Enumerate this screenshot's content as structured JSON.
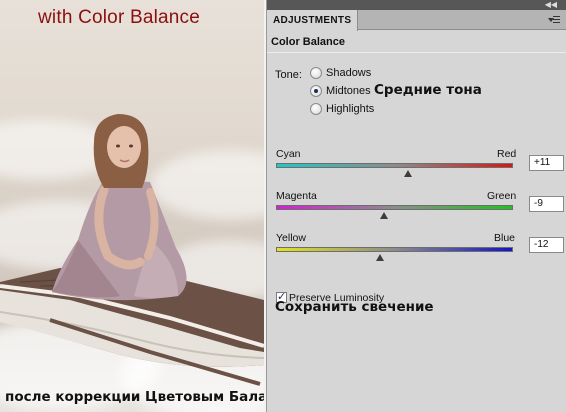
{
  "photo": {
    "title": "with Color Balance",
    "caption": "после коррекции Цветовым Балансом"
  },
  "panel": {
    "tab_label": "ADJUSTMENTS",
    "title": "Color Balance",
    "tone_label": "Tone:",
    "tones": [
      {
        "label": "Shadows",
        "selected": false
      },
      {
        "label": "Midtones",
        "selected": true
      },
      {
        "label": "Highlights",
        "selected": false
      }
    ],
    "tone_annotation": "Средние тона",
    "sliders": [
      {
        "left_label": "Cyan",
        "right_label": "Red",
        "value": "+11",
        "numeric": 11,
        "left_color": "#21c7c7",
        "right_color": "#d61616"
      },
      {
        "left_label": "Magenta",
        "right_label": "Green",
        "value": "-9",
        "numeric": -9,
        "left_color": "#d41fd4",
        "right_color": "#1fc21f"
      },
      {
        "left_label": "Yellow",
        "right_label": "Blue",
        "value": "-12",
        "numeric": -12,
        "left_color": "#e3e31c",
        "right_color": "#1414c8"
      }
    ],
    "slider_range": [
      -100,
      100
    ],
    "preserve_luminosity": {
      "label": "Preserve Luminosity",
      "checked": true
    },
    "preserve_annotation": "Сохранить свечение"
  },
  "icons": {
    "collapse": "double-chevron-right-icon",
    "menu": "panel-menu-icon",
    "check": "checkmark-icon"
  }
}
